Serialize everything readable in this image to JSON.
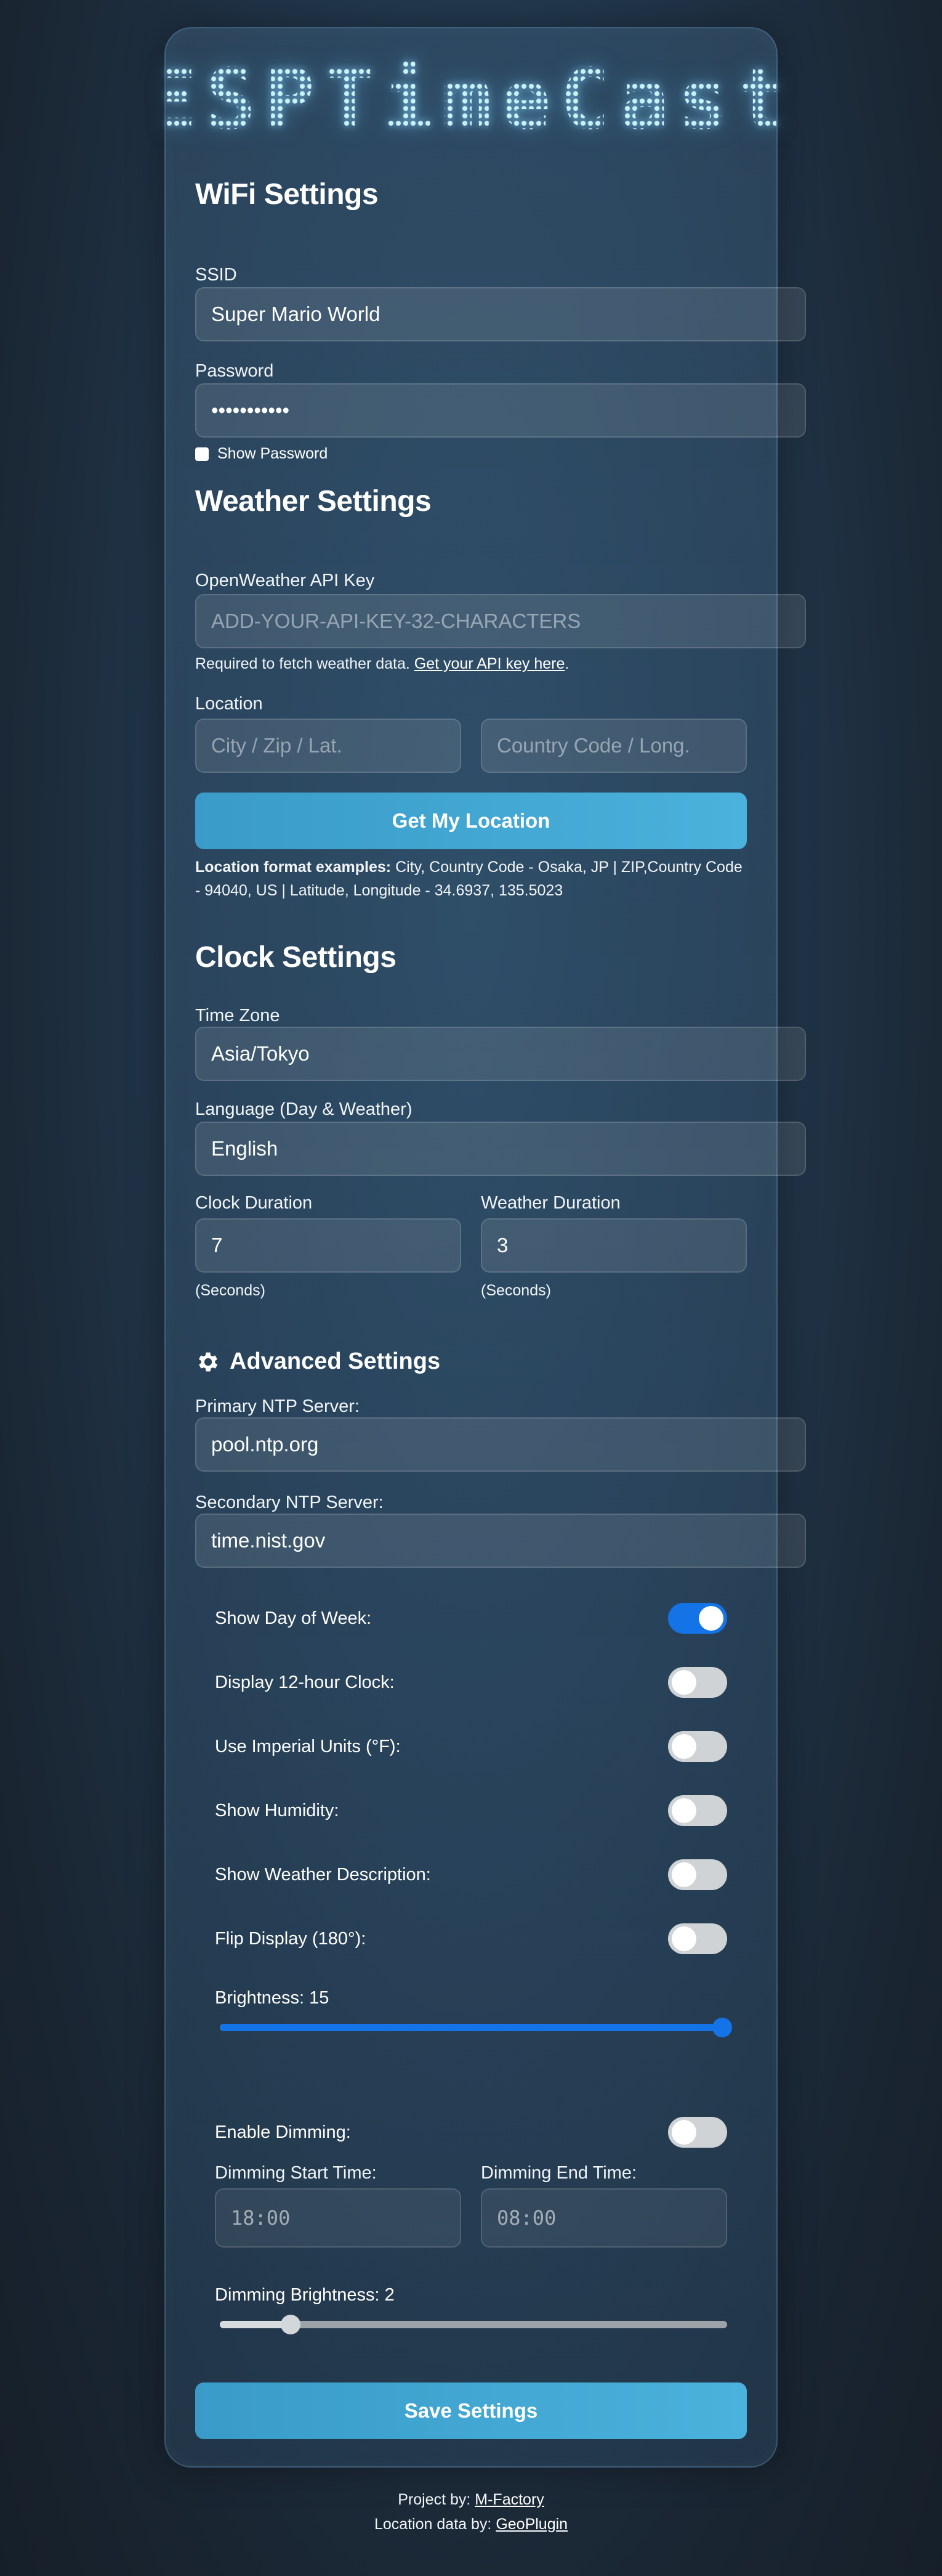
{
  "app": {
    "logo_text": "ESPTimeCast"
  },
  "wifi": {
    "heading": "WiFi Settings",
    "ssid_label": "SSID",
    "ssid_value": "Super Mario World",
    "password_label": "Password",
    "password_value": "•••••••••••",
    "show_password_label": "Show Password"
  },
  "weather": {
    "heading": "Weather Settings",
    "api_key_label": "OpenWeather API Key",
    "api_key_placeholder": "ADD-YOUR-API-KEY-32-CHARACTERS",
    "api_help_text": "Required to fetch weather data. ",
    "api_help_link": "Get your API key here",
    "api_help_end": ".",
    "location_label": "Location",
    "city_placeholder": "City / Zip / Lat.",
    "country_placeholder": "Country Code / Long.",
    "get_location_button": "Get My Location",
    "format_bold": "Location format examples:",
    "format_text": " City, Country Code - Osaka, JP | ZIP,Country Code - 94040, US | Latitude, Longitude - 34.6937, 135.5023"
  },
  "clock": {
    "heading": "Clock Settings",
    "timezone_label": "Time Zone",
    "timezone_value": "Asia/Tokyo",
    "language_label": "Language (Day & Weather)",
    "language_value": "English",
    "clock_duration_label": "Clock Duration",
    "clock_duration_value": "7",
    "weather_duration_label": "Weather Duration",
    "weather_duration_value": "3",
    "seconds_note": "(Seconds)"
  },
  "advanced": {
    "heading": "Advanced Settings",
    "icon": "gear-icon",
    "primary_ntp_label": "Primary NTP Server:",
    "primary_ntp_value": "pool.ntp.org",
    "secondary_ntp_label": "Secondary NTP Server:",
    "secondary_ntp_value": "time.nist.gov",
    "toggles": [
      {
        "label": "Show Day of Week:",
        "on": true
      },
      {
        "label": "Display 12-hour Clock:",
        "on": false
      },
      {
        "label": "Use Imperial Units (°F):",
        "on": false
      },
      {
        "label": "Show Humidity:",
        "on": false
      },
      {
        "label": "Show Weather Description:",
        "on": false
      },
      {
        "label": "Flip Display (180°):",
        "on": false
      }
    ],
    "brightness_label": "Brightness: 15",
    "brightness_fraction": 1.0,
    "dimming_label": "Enable Dimming:",
    "dimming_on": false,
    "dim_start_label": "Dimming Start Time:",
    "dim_start_value": "18:00",
    "dim_end_label": "Dimming End Time:",
    "dim_end_value": "08:00",
    "dim_brightness_label": "Dimming Brightness: 2",
    "dim_brightness_fraction": 0.14
  },
  "save_button": "Save Settings",
  "footer": {
    "project_prefix": "Project by: ",
    "project_link": "M-Factory",
    "location_prefix": "Location data by: ",
    "location_link": "GeoPlugin"
  },
  "colors": {
    "accent": "#1473e6",
    "button": "#45a9d6",
    "toggle_off": "#cfd3d6"
  }
}
